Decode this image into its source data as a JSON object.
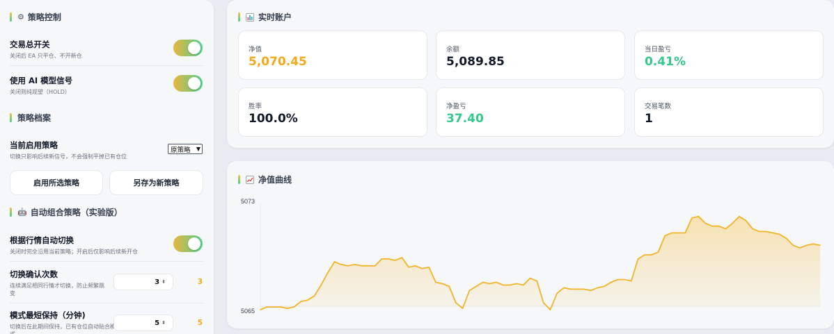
{
  "colors": {
    "accent_gold": "#f0a91a",
    "accent_green": "#34c98b",
    "toggle_gradient": [
      "#e9b53f",
      "#4fd08e"
    ]
  },
  "control": {
    "title": "策略控制",
    "title_icon": "gear-icon",
    "master": {
      "label": "交易总开关",
      "sub": "关闭后 EA 只平仓、不开新仓",
      "on": true
    },
    "ai": {
      "label": "使用 AI 模型信号",
      "sub": "关闭则纯观望（HOLD）",
      "on": true
    }
  },
  "profile": {
    "title": "策略档案",
    "current_label": "当前启用策略",
    "current_sub": "切换只影响后续新信号，不会强制平掉已有仓位",
    "selected": "原策略",
    "apply_btn": "启用所选策略",
    "save_btn": "另存为新策略"
  },
  "auto": {
    "title": "自动组合策略（实验版）",
    "title_icon": "robot-icon",
    "switch_label": "根据行情自动切换",
    "switch_sub": "关闭时完全沿用当前策略；开启后仅影响后续新开仓",
    "switch_on": true,
    "confirm_label": "切换确认次数",
    "confirm_sub": "连续满足相同行情才切换，防止频繁跳变",
    "confirm_input": "3",
    "confirm_value": "3",
    "hold_label": "模式最短保持（分钟)",
    "hold_sub": "切换后在此期间保持，已有仓位自动贴合模式",
    "hold_input": "5",
    "hold_value": "5"
  },
  "account": {
    "title": "实时账户",
    "title_icon": "bar-chart-icon",
    "stats": [
      {
        "label": "净值",
        "value": "5,070.45",
        "color": "#f0a91a"
      },
      {
        "label": "余额",
        "value": "5,089.85",
        "color": "#111827"
      },
      {
        "label": "当日盈亏",
        "value": "0.41%",
        "color": "#34c98b"
      },
      {
        "label": "胜率",
        "value": "100.0%",
        "color": "#111827"
      },
      {
        "label": "净盈亏",
        "value": "37.40",
        "color": "#34c98b"
      },
      {
        "label": "交易笔数",
        "value": "1",
        "color": "#111827"
      }
    ]
  },
  "equity": {
    "title": "净值曲线",
    "title_icon": "trend-icon"
  },
  "chart_data": {
    "type": "area",
    "title": "净值曲线",
    "ylim": [
      5065,
      5073
    ],
    "tick_labels": [
      "5073",
      "5065"
    ],
    "color": "#f0b429",
    "grid": false,
    "values": [
      5065.1,
      5065.3,
      5065.3,
      5065.3,
      5065.2,
      5065.3,
      5065.7,
      5065.8,
      5066.1,
      5066.9,
      5067.8,
      5068.6,
      5068.4,
      5068.3,
      5068.4,
      5068.3,
      5068.3,
      5068.3,
      5068.8,
      5068.8,
      5068.7,
      5068.9,
      5068.2,
      5068.3,
      5068.1,
      5068.2,
      5067.1,
      5067.0,
      5066.8,
      5065.6,
      5065.2,
      5066.5,
      5066.8,
      5067.1,
      5067.0,
      5067.1,
      5066.9,
      5066.9,
      5067.0,
      5066.9,
      5067.4,
      5067.2,
      5065.6,
      5065.1,
      5066.3,
      5066.7,
      5066.6,
      5066.6,
      5066.6,
      5066.5,
      5066.7,
      5066.8,
      5067.1,
      5067.3,
      5067.3,
      5067.2,
      5068.8,
      5069.1,
      5069.1,
      5069.3,
      5070.5,
      5070.7,
      5070.7,
      5070.7,
      5071.8,
      5071.9,
      5071.4,
      5071.2,
      5071.2,
      5071.0,
      5071.4,
      5071.9,
      5071.6,
      5071.0,
      5070.8,
      5070.8,
      5070.7,
      5070.6,
      5070.3,
      5069.8,
      5069.6,
      5069.8,
      5069.9,
      5069.8
    ]
  }
}
